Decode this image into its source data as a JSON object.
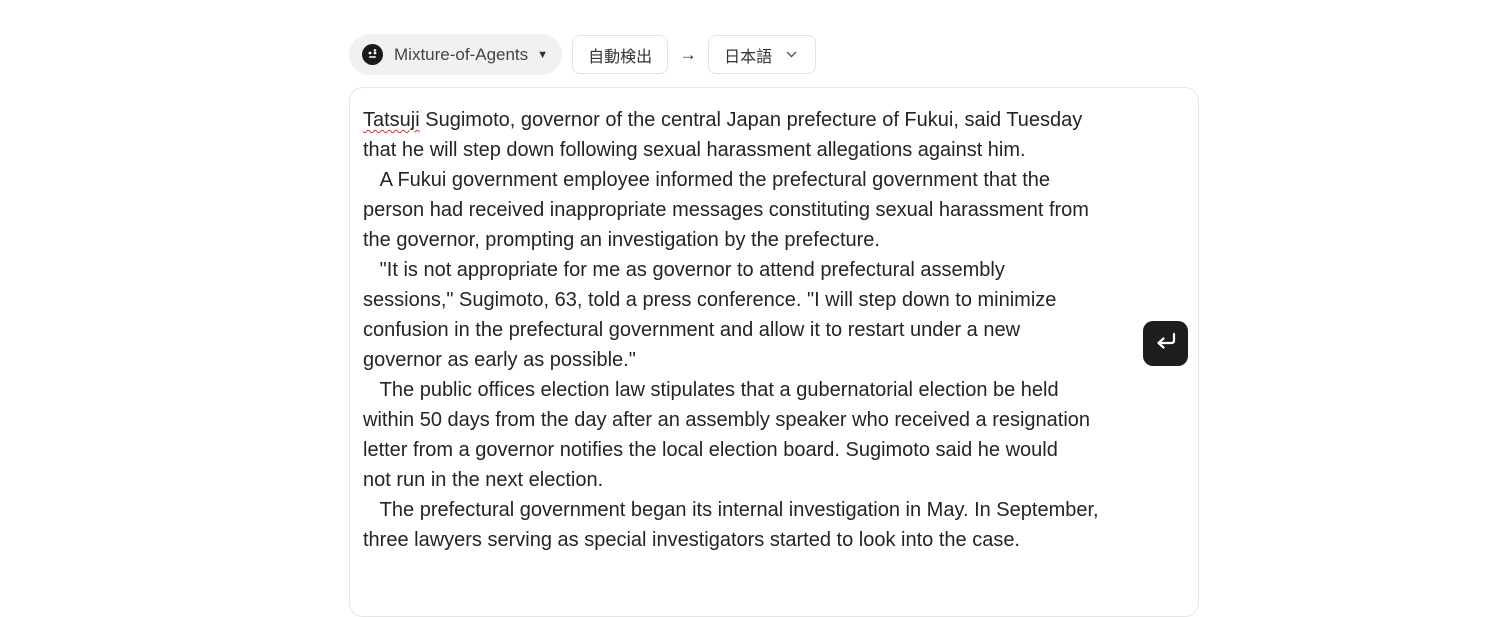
{
  "toolbar": {
    "model": {
      "label": "Mixture-of-Agents",
      "icon": "agents-icon"
    },
    "source_language": "自動検出",
    "arrow": "→",
    "target_language": "日本語"
  },
  "editor": {
    "first_word": "Tatsuji",
    "text_rest": " Sugimoto, governor of the central Japan prefecture of Fukui, said Tuesday\nthat he will step down following sexual harassment allegations against him.\n   A Fukui government employee informed the prefectural government that the\nperson had received inappropriate messages constituting sexual harassment from\nthe governor, prompting an investigation by the prefecture.\n   \"It is not appropriate for me as governor to attend prefectural assembly\nsessions,\" Sugimoto, 63, told a press conference. \"I will step down to minimize\nconfusion in the prefectural government and allow it to restart under a new\ngovernor as early as possible.\"\n   The public offices election law stipulates that a gubernatorial election be held\nwithin 50 days from the day after an assembly speaker who received a resignation\nletter from a governor notifies the local election board. Sugimoto said he would\nnot run in the next election.\n   The prefectural government began its internal investigation in May. In September,\nthree lawyers serving as special investigators started to look into the case.",
    "submit_icon": "enter-icon"
  }
}
